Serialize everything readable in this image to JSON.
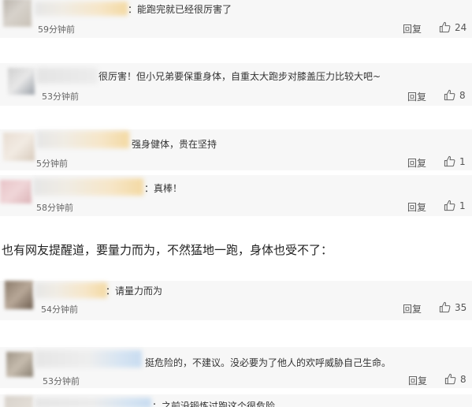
{
  "comments_top": [
    {
      "text": "：能跑完就已经很厉害了",
      "time": "59分钟前",
      "reply": "回复",
      "likes": "24"
    },
    {
      "text": "很厉害！但小兄弟要保重身体，自重太大跑步对膝盖压力比较大吧~",
      "time": "53分钟前",
      "reply": "回复",
      "likes": "8"
    },
    {
      "text": "强身健体，贵在坚持",
      "time": "5分钟前",
      "reply": "回复",
      "likes": "1"
    },
    {
      "text": "：真棒！",
      "time": "58分钟前",
      "reply": "回复",
      "likes": "1"
    }
  ],
  "article": {
    "text": "也有网友提醒道，要量力而为，不然猛地一跑，身体也受不了："
  },
  "comments_bottom": [
    {
      "text": "：请量力而为",
      "time": "54分钟前",
      "reply": "回复",
      "likes": "35"
    },
    {
      "text": "挺危险的，不建议。没必要为了他人的欢呼威胁自己生命。",
      "time": "53分钟前",
      "reply": "回复",
      "likes": "8"
    },
    {
      "text": "：之前没锻炼过跑这个很危险",
      "time": "",
      "reply": "",
      "likes": ""
    }
  ],
  "icons": {
    "like": "thumbs-up-icon"
  }
}
